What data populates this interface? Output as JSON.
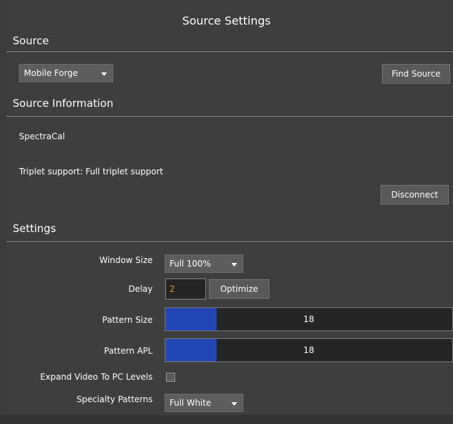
{
  "title": "Source Settings",
  "source": {
    "header": "Source",
    "dropdown_value": "Mobile Forge",
    "find_button": "Find Source"
  },
  "info": {
    "header": "Source Information",
    "name": "SpectraCal",
    "triplet": "Triplet support: Full triplet support",
    "disconnect_button": "Disconnect"
  },
  "settings": {
    "header": "Settings",
    "window_size": {
      "label": "Window Size",
      "value": "Full 100%"
    },
    "delay": {
      "label": "Delay",
      "value": "2",
      "optimize_button": "Optimize"
    },
    "pattern_size": {
      "label": "Pattern Size",
      "value": "18",
      "fill_fraction": 0.18
    },
    "pattern_apl": {
      "label": "Pattern APL",
      "value": "18",
      "fill_fraction": 0.18
    },
    "expand_video": {
      "label": "Expand Video To PC Levels",
      "checked": false
    },
    "specialty": {
      "label": "Specialty Patterns",
      "value": "Full White"
    }
  },
  "colors": {
    "accent_fill": "#2347b5",
    "delay_text": "#f09a2a"
  }
}
